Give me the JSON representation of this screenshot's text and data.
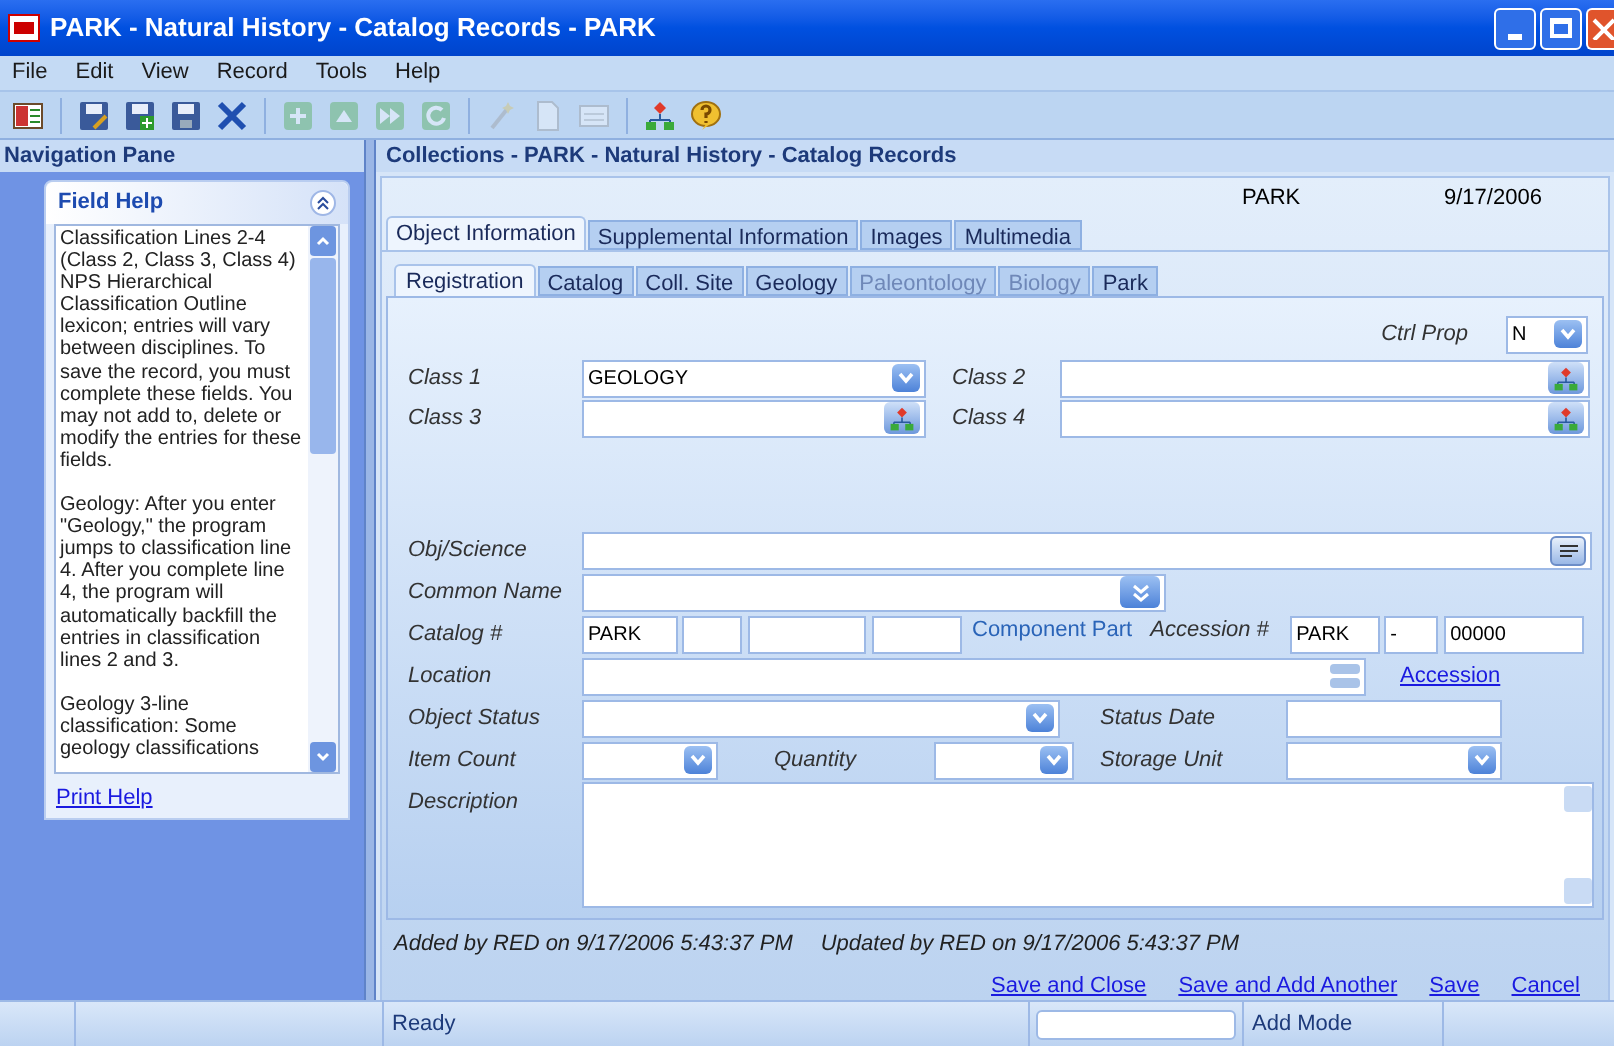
{
  "window": {
    "title": "PARK - Natural History - Catalog Records  - PARK"
  },
  "menu": [
    "File",
    "Edit",
    "View",
    "Record",
    "Tools",
    "Help"
  ],
  "toolbar": [
    {
      "kind": "panel",
      "disabled": false
    },
    {
      "kind": "separator"
    },
    {
      "kind": "save-edit",
      "disabled": false
    },
    {
      "kind": "save-new",
      "disabled": false
    },
    {
      "kind": "save",
      "disabled": false
    },
    {
      "kind": "delete",
      "disabled": false
    },
    {
      "kind": "separator"
    },
    {
      "kind": "add",
      "disabled": true
    },
    {
      "kind": "up",
      "disabled": true
    },
    {
      "kind": "forward",
      "disabled": true
    },
    {
      "kind": "refresh",
      "disabled": true
    },
    {
      "kind": "separator"
    },
    {
      "kind": "wand",
      "disabled": true
    },
    {
      "kind": "page",
      "disabled": true
    },
    {
      "kind": "form",
      "disabled": true
    },
    {
      "kind": "separator"
    },
    {
      "kind": "hierarchy",
      "disabled": false
    },
    {
      "kind": "help",
      "disabled": false
    }
  ],
  "nav_pane": {
    "title": "Navigation Pane",
    "field_help": {
      "title": "Field Help",
      "paragraphs": [
        [
          "Classification Lines 2-4 (Class 2, Class 3, Class 4)",
          "NPS Hierarchical Classification Outline lexicon; entries will vary between disciplines.  To save the record, you must complete these fields.  You may not add to, delete or modify the entries for these fields."
        ],
        [
          "Geology:  After you enter \"Geology,\" the program jumps to classification line 4.  After you complete line 4, the program will automatically backfill the entries in classification lines 2 and 3."
        ],
        [
          "Geology 3-line classification: Some geology classifications"
        ]
      ],
      "print_link": "Print Help"
    }
  },
  "content": {
    "title": "Collections - PARK - Natural History - Catalog Records",
    "park": "PARK",
    "date": "9/17/2006",
    "tabs": [
      {
        "label": "Object Information",
        "selected": true
      },
      {
        "label": "Supplemental Information",
        "selected": false
      },
      {
        "label": "Images",
        "selected": false
      },
      {
        "label": "Multimedia",
        "selected": false
      }
    ],
    "subtabs": [
      {
        "label": "Registration",
        "selected": true,
        "disabled": false
      },
      {
        "label": "Catalog",
        "selected": false,
        "disabled": false
      },
      {
        "label": "Coll. Site",
        "selected": false,
        "disabled": false
      },
      {
        "label": "Geology",
        "selected": false,
        "disabled": false
      },
      {
        "label": "Paleontology",
        "selected": false,
        "disabled": true
      },
      {
        "label": "Biology",
        "selected": false,
        "disabled": true
      },
      {
        "label": "Park",
        "selected": false,
        "disabled": false
      }
    ],
    "form": {
      "ctrl_prop": {
        "label": "Ctrl Prop",
        "value": "N",
        "kind": "dropdown"
      },
      "class_1": {
        "label": "Class 1",
        "value": "GEOLOGY",
        "kind": "dropdown"
      },
      "class_2": {
        "label": "Class 2",
        "kind": "tree"
      },
      "class_3": {
        "label": "Class 3",
        "kind": "tree"
      },
      "class_4": {
        "label": "Class 4",
        "kind": "tree"
      },
      "obj_science": {
        "label": "Obj/Science",
        "kind": "list"
      },
      "common_name": {
        "label": "Common Name",
        "kind": "double-down"
      },
      "catalog": {
        "label": "Catalog #",
        "value": "PARK"
      },
      "component_part": "Component Part",
      "accession_number": {
        "label": "Accession #",
        "prefix": "PARK",
        "separator": "-",
        "number": "00000"
      },
      "location": {
        "label": "Location",
        "kind": "scroll"
      },
      "accession_link": "Accession",
      "object_status": {
        "label": "Object Status",
        "kind": "dropdown"
      },
      "status_date": {
        "label": "Status Date"
      },
      "item_count": {
        "label": "Item Count",
        "kind": "dropdown"
      },
      "quantity": {
        "label": "Quantity",
        "kind": "dropdown"
      },
      "storage_unit": {
        "label": "Storage Unit",
        "kind": "dropdown"
      },
      "description": {
        "label": "Description"
      }
    },
    "audit": [
      "Added by RED on 9/17/2006 5:43:37 PM",
      "Updated by RED on 9/17/2006 5:43:37 PM"
    ],
    "actions": [
      "Save and Close",
      "Save and Add Another",
      "Save",
      "Cancel"
    ]
  },
  "status_bar": {
    "message": "Ready",
    "mode": "Add Mode"
  }
}
